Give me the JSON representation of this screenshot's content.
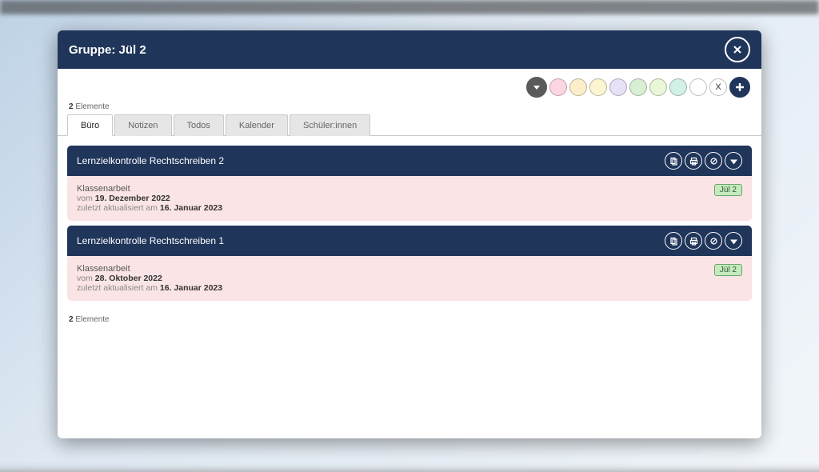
{
  "header": {
    "title_prefix": "Gruppe: ",
    "title_group": "Jül 2"
  },
  "colorbar": {
    "x_label": "X",
    "colors": [
      "#fcd6e3",
      "#fdeecb",
      "#fbf5d2",
      "#e8e0f6",
      "#d8efd3",
      "#e9f6d7",
      "#d2f0e6",
      "#ffffff"
    ]
  },
  "counts": {
    "top_n": "2",
    "top_label": "Elemente",
    "bottom_n": "2",
    "bottom_label": "Elemente"
  },
  "tabs": [
    {
      "label": "Büro",
      "active": true
    },
    {
      "label": "Notizen",
      "active": false
    },
    {
      "label": "Todos",
      "active": false
    },
    {
      "label": "Kalender",
      "active": false
    },
    {
      "label": "Schüler:innen",
      "active": false
    }
  ],
  "items": [
    {
      "title": "Lernzielkontrolle Rechtschreiben 2",
      "type": "Klassenarbeit",
      "date_prefix": "vom ",
      "date": "19. Dezember 2022",
      "updated_prefix": "zuletzt aktualisiert am ",
      "updated": "16. Januar 2023",
      "tag": "Jül 2"
    },
    {
      "title": "Lernzielkontrolle Rechtschreiben 1",
      "type": "Klassenarbeit",
      "date_prefix": "vom ",
      "date": "28. Oktober 2022",
      "updated_prefix": "zuletzt aktualisiert am ",
      "updated": "16. Januar 2023",
      "tag": "Jül 2"
    }
  ]
}
